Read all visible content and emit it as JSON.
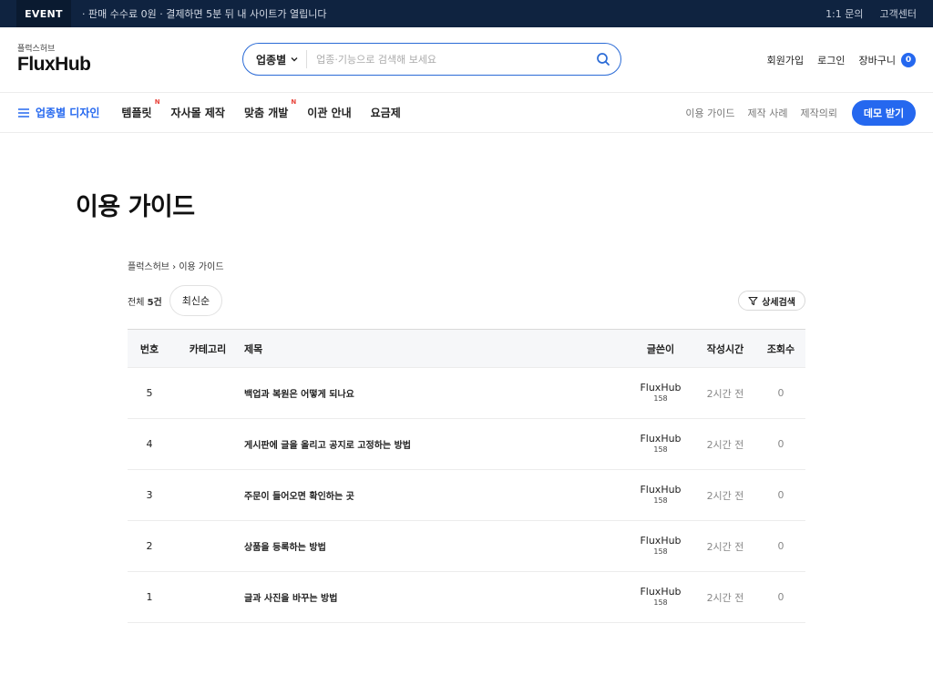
{
  "topbar": {
    "event_tag": "EVENT",
    "event_text": "· 판매 수수료 0원 · 결제하면 5분 뒤 내 사이트가 열립니다",
    "links": [
      "1:1 문의",
      "고객센터"
    ]
  },
  "header": {
    "logo_sub": "플럭스허브",
    "logo_main": "FluxHub",
    "search": {
      "category": "업종별",
      "value": "",
      "placeholder": "업종·기능으로 검색해 보세요"
    },
    "signup": "회원가입",
    "login": "로그인",
    "cart_label": "장바구니",
    "cart_count": "0"
  },
  "nav": {
    "category": "업종별 디자인",
    "items": [
      {
        "label": "템플릿",
        "new": "N"
      },
      {
        "label": "자사몰 제작",
        "new": ""
      },
      {
        "label": "맞춤 개발",
        "new": "N"
      },
      {
        "label": "이관 안내",
        "new": ""
      },
      {
        "label": "요금제",
        "new": ""
      }
    ],
    "right_links": [
      "이용 가이드",
      "제작 사례",
      "제작의뢰"
    ],
    "demo_button": "데모 받기"
  },
  "main": {
    "title": "이용 가이드",
    "breadcrumb": "플럭스허브 › 이용 가이드",
    "count_prefix": "전체 ",
    "count": "5건",
    "sort": "최신순",
    "filter": "상세검색",
    "table": {
      "headers": [
        "번호",
        "카테고리",
        "제목",
        "글쓴이",
        "작성시간",
        "조회수"
      ],
      "rows": [
        {
          "no": "5",
          "category": "",
          "title": "백업과 복원은 어떻게 되나요",
          "author": "FluxHub",
          "author_id": "158",
          "time": "2시간 전",
          "views": "0"
        },
        {
          "no": "4",
          "category": "",
          "title": "게시판에 글을 올리고 공지로 고정하는 방법",
          "author": "FluxHub",
          "author_id": "158",
          "time": "2시간 전",
          "views": "0"
        },
        {
          "no": "3",
          "category": "",
          "title": "주문이 들어오면 확인하는 곳",
          "author": "FluxHub",
          "author_id": "158",
          "time": "2시간 전",
          "views": "0"
        },
        {
          "no": "2",
          "category": "",
          "title": "상품을 등록하는 방법",
          "author": "FluxHub",
          "author_id": "158",
          "time": "2시간 전",
          "views": "0"
        },
        {
          "no": "1",
          "category": "",
          "title": "글과 사진을 바꾸는 방법",
          "author": "FluxHub",
          "author_id": "158",
          "time": "2시간 전",
          "views": "0"
        }
      ]
    }
  },
  "colors": {
    "topbar": "#0f2340",
    "accent": "#2568ef",
    "new_badge": "#e8453c"
  },
  "icons": [
    "chevron-down-icon",
    "search-icon",
    "menu-icon",
    "filter-icon"
  ]
}
